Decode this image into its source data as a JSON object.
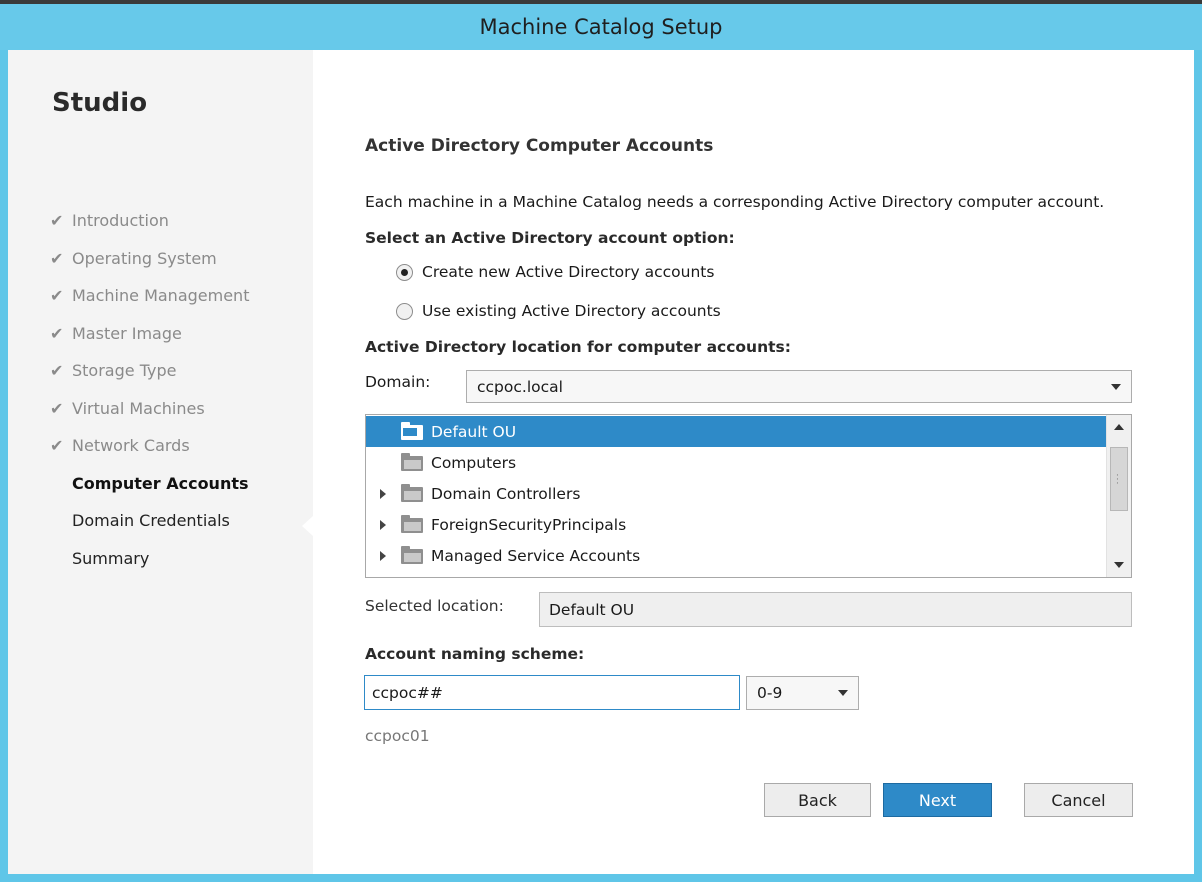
{
  "window": {
    "title": "Machine Catalog Setup"
  },
  "sidebar": {
    "brand": "Studio",
    "steps": [
      {
        "label": "Introduction",
        "state": "done"
      },
      {
        "label": "Operating System",
        "state": "done"
      },
      {
        "label": "Machine Management",
        "state": "done"
      },
      {
        "label": "Master Image",
        "state": "done"
      },
      {
        "label": "Storage Type",
        "state": "done"
      },
      {
        "label": "Virtual Machines",
        "state": "done"
      },
      {
        "label": "Network Cards",
        "state": "done"
      },
      {
        "label": "Computer Accounts",
        "state": "current"
      },
      {
        "label": "Domain Credentials",
        "state": "pending"
      },
      {
        "label": "Summary",
        "state": "pending"
      }
    ],
    "check_glyph": "✔"
  },
  "main": {
    "title": "Active Directory Computer Accounts",
    "description": "Each machine in a Machine Catalog needs a corresponding Active Directory computer account.",
    "account_option_label": "Select an Active Directory account option:",
    "options": [
      {
        "label": "Create new Active Directory accounts",
        "selected": true
      },
      {
        "label": "Use existing Active Directory accounts",
        "selected": false
      }
    ],
    "location_label": "Active Directory location for computer accounts:",
    "domain_label": "Domain:",
    "domain_value": "ccpoc.local",
    "tree": [
      {
        "label": "Default OU",
        "selected": true,
        "expandable": false,
        "icon": "ou-folder-icon"
      },
      {
        "label": "Computers",
        "selected": false,
        "expandable": false,
        "icon": "folder-icon"
      },
      {
        "label": "Domain Controllers",
        "selected": false,
        "expandable": true,
        "icon": "folder-icon"
      },
      {
        "label": "ForeignSecurityPrincipals",
        "selected": false,
        "expandable": true,
        "icon": "folder-icon"
      },
      {
        "label": "Managed Service Accounts",
        "selected": false,
        "expandable": true,
        "icon": "folder-icon"
      }
    ],
    "selected_location_label": "Selected location:",
    "selected_location_value": "Default OU",
    "naming_label": "Account naming scheme:",
    "naming_value": "ccpoc##",
    "naming_type": "0-9",
    "naming_preview": "ccpoc01"
  },
  "buttons": {
    "back": "Back",
    "next": "Next",
    "cancel": "Cancel"
  },
  "colors": {
    "accent": "#2e8ac8",
    "titlebar": "#67c9ea",
    "frame": "#f4f4f4"
  }
}
